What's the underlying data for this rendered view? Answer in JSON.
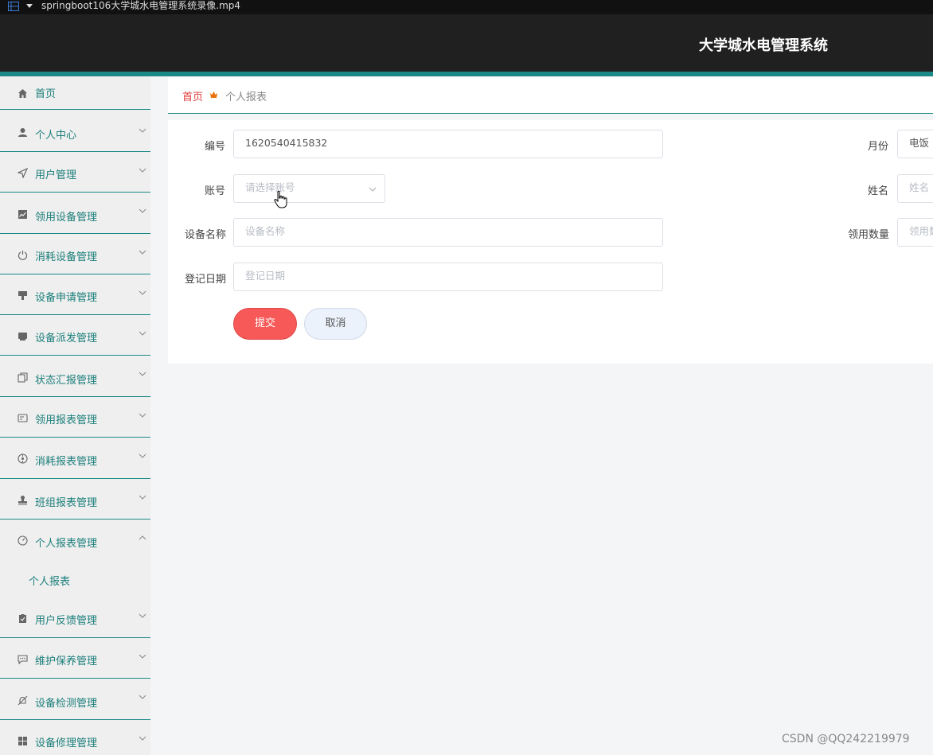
{
  "player": {
    "filename": "springboot106大学城水电管理系统录像.mp4"
  },
  "header": {
    "title": "大学城水电管理系统"
  },
  "sidebar": {
    "items": [
      {
        "label": "首页",
        "icon": "home-icon"
      },
      {
        "label": "个人中心",
        "icon": "user-icon"
      },
      {
        "label": "用户管理",
        "icon": "send-icon"
      },
      {
        "label": "领用设备管理",
        "icon": "chart-icon"
      },
      {
        "label": "消耗设备管理",
        "icon": "power-icon"
      },
      {
        "label": "设备申请管理",
        "icon": "brush-icon"
      },
      {
        "label": "设备派发管理",
        "icon": "box-icon"
      },
      {
        "label": "状态汇报管理",
        "icon": "copy-icon"
      },
      {
        "label": "领用报表管理",
        "icon": "card-icon"
      },
      {
        "label": "消耗报表管理",
        "icon": "compass-icon"
      },
      {
        "label": "班组报表管理",
        "icon": "stamp-icon"
      },
      {
        "label": "个人报表管理",
        "icon": "gauge-icon"
      },
      {
        "label": "用户反馈管理",
        "icon": "clipboard-icon"
      },
      {
        "label": "维护保养管理",
        "icon": "chat-icon"
      },
      {
        "label": "设备检测管理",
        "icon": "bell-off-icon"
      },
      {
        "label": "设备修理管理",
        "icon": "grid-icon"
      }
    ],
    "subitem": {
      "label": "个人报表"
    }
  },
  "breadcrumb": {
    "home": "首页",
    "current": "个人报表"
  },
  "form": {
    "bianhao": {
      "label": "编号",
      "value": "1620540415832"
    },
    "yuefen": {
      "label": "月份",
      "value": "电饭"
    },
    "zhanghao": {
      "label": "账号",
      "placeholder": "请选择账号"
    },
    "xingming": {
      "label": "姓名",
      "placeholder": "姓名"
    },
    "shebeimingcheng": {
      "label": "设备名称",
      "placeholder": "设备名称"
    },
    "lingyongshuliang": {
      "label": "领用数量",
      "placeholder": "领用数"
    },
    "dengjiriqi": {
      "label": "登记日期",
      "placeholder": "登记日期"
    },
    "submit": "提交",
    "cancel": "取消"
  },
  "watermark": "CSDN @QQ242219979",
  "colors": {
    "accent": "#1b8a86",
    "primary_button": "#f75959",
    "header_bg": "#202020"
  }
}
